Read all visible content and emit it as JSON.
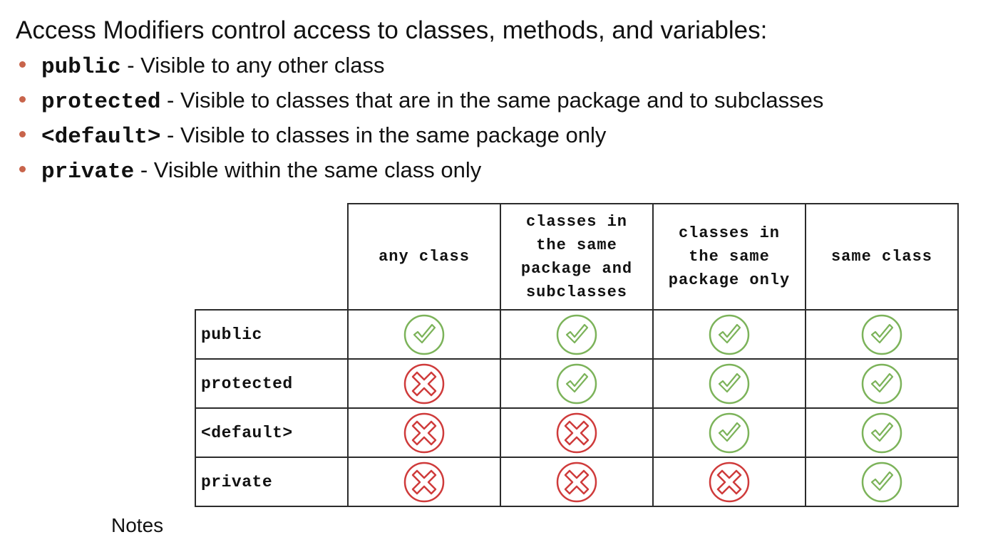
{
  "slide": {
    "title": "Access Modifiers control access to classes, methods, and variables:",
    "bullets": [
      {
        "keyword": "public",
        "text": " - Visible to any other class"
      },
      {
        "keyword": "protected",
        "text": " - Visible to classes that are in the same package and to subclasses"
      },
      {
        "keyword": "<default>",
        "text": " - Visible to classes in the same package only"
      },
      {
        "keyword": "private",
        "text": " - Visible within the same class only"
      }
    ],
    "notes_label": "Notes"
  },
  "table": {
    "columns": [
      "any class",
      "classes in\nthe same\npackage and\nsubclasses",
      "classes in\nthe same\npackage only",
      "same class"
    ],
    "rows": [
      {
        "label": "public",
        "access": [
          true,
          true,
          true,
          true
        ]
      },
      {
        "label": "protected",
        "access": [
          false,
          true,
          true,
          true
        ]
      },
      {
        "label": "<default>",
        "access": [
          false,
          false,
          true,
          true
        ]
      },
      {
        "label": "private",
        "access": [
          false,
          false,
          false,
          true
        ]
      }
    ]
  },
  "icons": {
    "allowed": "check-circle-icon",
    "denied": "x-circle-icon"
  },
  "colors": {
    "bullet": "#c8644b",
    "allowed": "#7cb35a",
    "denied": "#cf3b3b"
  }
}
